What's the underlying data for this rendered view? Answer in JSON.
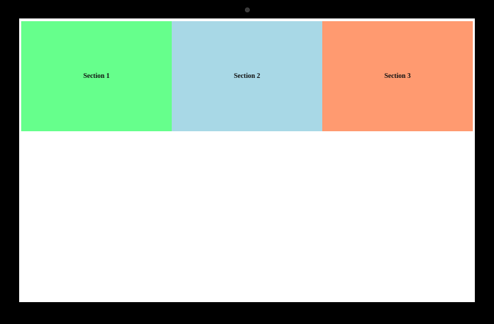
{
  "colors": {
    "bezel": "#000000",
    "screen_background": "#ffffff"
  },
  "sections": [
    {
      "label": "Section 1",
      "color": "#66ff8c"
    },
    {
      "label": "Section 2",
      "color": "#a8d8e6"
    },
    {
      "label": "Section 3",
      "color": "#ff9a70"
    }
  ]
}
